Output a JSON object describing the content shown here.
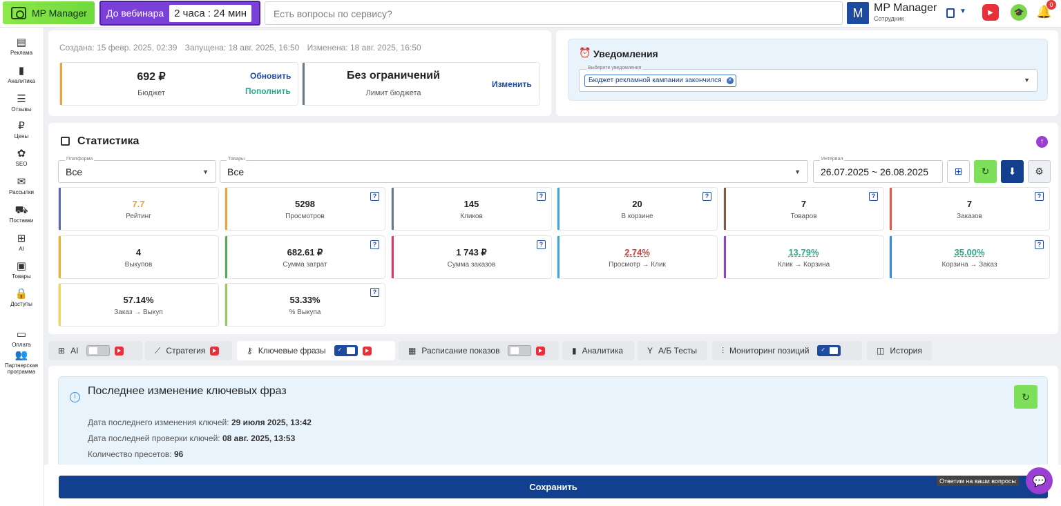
{
  "header": {
    "logo": "MP Manager",
    "webinar_label": "До вебинара",
    "webinar_timer": "2 часа : 24 мин",
    "search_placeholder": "Есть вопросы по сервису?",
    "account_letter": "M",
    "account_name": "MP Manager",
    "account_role": "Сотрудник",
    "notifications_count": "0"
  },
  "sidebar": [
    {
      "label": "Реклама",
      "icon": "ads-icon",
      "glyph": "▤"
    },
    {
      "label": "Аналитика",
      "icon": "analytics-icon",
      "glyph": "▮"
    },
    {
      "label": "Отзывы",
      "icon": "reviews-icon",
      "glyph": "☰"
    },
    {
      "label": "Цены",
      "icon": "ruble-icon",
      "glyph": "₽"
    },
    {
      "label": "SEO",
      "icon": "seo-icon",
      "glyph": "✿"
    },
    {
      "label": "Рассылки",
      "icon": "mail-icon",
      "glyph": "✉"
    },
    {
      "label": "Поставки",
      "icon": "truck-icon",
      "glyph": "⛟"
    },
    {
      "label": "AI",
      "icon": "chip-icon",
      "glyph": "⊞"
    },
    {
      "label": "Товары",
      "icon": "box-icon",
      "glyph": "▣"
    },
    {
      "label": "Доступы",
      "icon": "lock-icon",
      "glyph": "🔒"
    },
    {
      "label": "Оплата",
      "icon": "wallet-icon",
      "glyph": "▭"
    },
    {
      "label": "Партнерская программа",
      "icon": "partners-icon",
      "glyph": "👥"
    }
  ],
  "campaign": {
    "created": "Создана: 15 февр. 2025, 02:39",
    "started": "Запущена: 18 авг. 2025, 16:50",
    "changed": "Изменена: 18 авг. 2025, 16:50",
    "budget_value": "692 ₽",
    "budget_label": "Бюджет",
    "budget_update": "Обновить",
    "budget_topup": "Пополнить",
    "limit_value": "Без ограничений",
    "limit_label": "Лимит бюджета",
    "limit_change": "Изменить"
  },
  "notifications": {
    "title": "Уведомления",
    "select_label": "Выберите уведомления",
    "chip": "Бюджет рекламной кампании закончился"
  },
  "stats": {
    "title": "Статистика",
    "platform_label": "Платформа",
    "platform_value": "Все",
    "goods_label": "Товары",
    "goods_value": "Все",
    "interval_label": "Интервал",
    "interval_value": "26.07.2025 ~ 26.08.2025",
    "metrics": [
      {
        "value": "7.7",
        "label": "Рейтинг",
        "color": "#5a6bb0",
        "val_color": "#e0a33a",
        "q": false
      },
      {
        "value": "5298",
        "label": "Просмотров",
        "color": "#e8a53a",
        "val_color": "#222",
        "q": true
      },
      {
        "value": "145",
        "label": "Кликов",
        "color": "#6a7a88",
        "val_color": "#222",
        "q": true
      },
      {
        "value": "20",
        "label": "В корзине",
        "color": "#3aa8d8",
        "val_color": "#222",
        "q": true
      },
      {
        "value": "7",
        "label": "Товаров",
        "color": "#7a5a48",
        "val_color": "#222",
        "q": true
      },
      {
        "value": "7",
        "label": "Заказов",
        "color": "#e05a4a",
        "val_color": "#222",
        "q": true
      },
      {
        "value": "4",
        "label": "Выкупов",
        "color": "#e8b52a",
        "val_color": "#222",
        "q": false
      },
      {
        "value": "682.61 ₽",
        "label": "Сумма затрат",
        "color": "#5aa85a",
        "val_color": "#222",
        "q": true
      },
      {
        "value": "1 743 ₽",
        "label": "Сумма заказов",
        "color": "#d83a6a",
        "val_color": "#222",
        "q": true
      },
      {
        "value": "2.74%",
        "label": "Просмотр → Клик",
        "color": "#3aa8d8",
        "val_color": "#d23a3a",
        "q": false
      },
      {
        "value": "13.79%",
        "label": "Клик → Корзина",
        "color": "#8a4ab8",
        "val_color": "#2aa88a",
        "q": false
      },
      {
        "value": "35.00%",
        "label": "Корзина → Заказ",
        "color": "#3a8ad8",
        "val_color": "#2aa88a",
        "q": true
      },
      {
        "value": "57.14%",
        "label": "Заказ → Выкуп",
        "color": "#f0d85a",
        "val_color": "#222",
        "q": false
      },
      {
        "value": "53.33%",
        "label": "% Выкупа",
        "color": "#9ac85a",
        "val_color": "#222",
        "q": true
      }
    ]
  },
  "tabs": [
    {
      "label": "AI",
      "icon": "chip-icon",
      "glyph": "⊞",
      "toggle": "off",
      "yt": true,
      "active": false
    },
    {
      "label": "Стратегия",
      "icon": "strategy-icon",
      "glyph": "⟋",
      "toggle": null,
      "yt": true,
      "active": false
    },
    {
      "label": "Ключевые фразы",
      "icon": "key-icon",
      "glyph": "⚷",
      "toggle": "on",
      "yt": true,
      "active": true
    },
    {
      "label": "Расписание показов",
      "icon": "schedule-icon",
      "glyph": "▦",
      "toggle": "off",
      "yt": true,
      "active": false
    },
    {
      "label": "Аналитика",
      "icon": "analytics-icon",
      "glyph": "▮",
      "toggle": null,
      "yt": false,
      "active": false
    },
    {
      "label": "А/Б Тесты",
      "icon": "ab-icon",
      "glyph": "Y",
      "toggle": null,
      "yt": false,
      "active": false
    },
    {
      "label": "Мониторинг позиций",
      "icon": "monitor-icon",
      "glyph": "⫶",
      "toggle": "on",
      "yt": false,
      "active": false
    },
    {
      "label": "История",
      "icon": "history-icon",
      "glyph": "◫",
      "toggle": null,
      "yt": false,
      "active": false
    }
  ],
  "last_change": {
    "title": "Последнее изменение ключевых фраз",
    "keys_changed_label": "Дата последнего изменения ключей: ",
    "keys_changed_value": "29 июля 2025, 13:42",
    "keys_checked_label": "Дата последней проверки ключей: ",
    "keys_checked_value": "08 авг. 2025, 13:53",
    "presets_label": "Количество пресетов: ",
    "presets_value": "96"
  },
  "footer": {
    "save": "Сохранить",
    "help_tip": "Ответим на ваши вопросы"
  }
}
